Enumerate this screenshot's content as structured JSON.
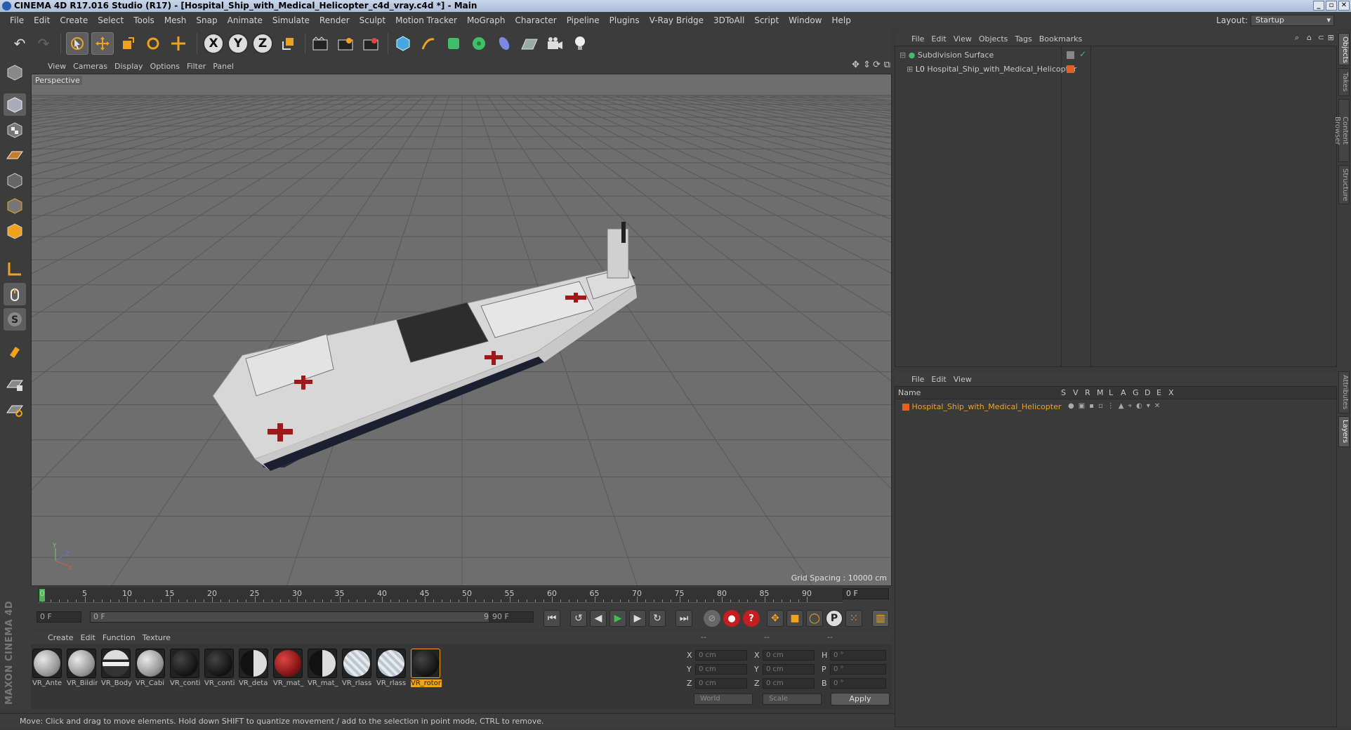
{
  "window": {
    "title": "CINEMA 4D R17.016 Studio (R17) - [Hospital_Ship_with_Medical_Helicopter_c4d_vray.c4d *] - Main"
  },
  "menubar": {
    "items": [
      "File",
      "Edit",
      "Create",
      "Select",
      "Tools",
      "Mesh",
      "Snap",
      "Animate",
      "Simulate",
      "Render",
      "Sculpt",
      "Motion Tracker",
      "MoGraph",
      "Character",
      "Pipeline",
      "Plugins",
      "V-Ray Bridge",
      "3DToAll",
      "Script",
      "Window",
      "Help"
    ],
    "layout_label": "Layout:",
    "layout_value": "Startup"
  },
  "toolbar": {
    "axis_x": "X",
    "axis_y": "Y",
    "axis_z": "Z"
  },
  "viewport": {
    "menu": [
      "View",
      "Cameras",
      "Display",
      "Options",
      "Filter",
      "Panel"
    ],
    "camera_label": "Perspective",
    "grid_spacing": "Grid Spacing : 10000 cm",
    "background_color": "#6e6e6e"
  },
  "timeline": {
    "ticks": [
      "0",
      "5",
      "10",
      "15",
      "20",
      "25",
      "30",
      "35",
      "40",
      "45",
      "50",
      "55",
      "60",
      "65",
      "70",
      "75",
      "80",
      "85",
      "90"
    ],
    "current_frame": "0 F"
  },
  "transport": {
    "start_field": "0 F",
    "range_start": "0 F",
    "range_end": "90 F",
    "end_field": "90 F"
  },
  "material_manager": {
    "menu": [
      "Create",
      "Edit",
      "Function",
      "Texture"
    ],
    "materials": [
      {
        "name": "VR_Ante",
        "style": "metal"
      },
      {
        "name": "VR_Bildir",
        "style": "metal"
      },
      {
        "name": "VR_Body",
        "style": "stripe"
      },
      {
        "name": "VR_Cabi",
        "style": "metal"
      },
      {
        "name": "VR_conti",
        "style": "dark"
      },
      {
        "name": "VR_conti",
        "style": "dark"
      },
      {
        "name": "VR_deta",
        "style": "dark-red"
      },
      {
        "name": "VR_mat_",
        "style": "red"
      },
      {
        "name": "VR_mat_",
        "style": "dark-red"
      },
      {
        "name": "VR_rlass",
        "style": "glass"
      },
      {
        "name": "VR_rlass",
        "style": "glass"
      },
      {
        "name": "VR_rotor",
        "style": "dark",
        "selected": true
      }
    ]
  },
  "coordinates": {
    "header": [
      "--",
      "--",
      "--"
    ],
    "rows": [
      {
        "pos_label": "X",
        "pos": "0 cm",
        "size_label": "X",
        "size": "0 cm",
        "rot_label": "H",
        "rot": "0 °"
      },
      {
        "pos_label": "Y",
        "pos": "0 cm",
        "size_label": "Y",
        "size": "0 cm",
        "rot_label": "P",
        "rot": "0 °"
      },
      {
        "pos_label": "Z",
        "pos": "0 cm",
        "size_label": "Z",
        "size": "0 cm",
        "rot_label": "B",
        "rot": "0 °"
      }
    ],
    "mode_world": "World",
    "mode_scale": "Scale",
    "apply": "Apply"
  },
  "branding": {
    "text": "MAXON CINEMA 4D"
  },
  "statusbar": {
    "text": "Move: Click and drag to move elements. Hold down SHIFT to quantize movement / add to the selection in point mode, CTRL to remove."
  },
  "object_manager": {
    "menu": [
      "File",
      "Edit",
      "View",
      "Objects",
      "Tags",
      "Bookmarks"
    ],
    "objects": [
      {
        "name": "Subdivision Surface",
        "icon": "subdivision-icon"
      },
      {
        "name": "Hospital_Ship_with_Medical_Helicopter",
        "icon": "null-object-icon"
      }
    ]
  },
  "layer_manager": {
    "menu": [
      "File",
      "Edit",
      "View"
    ],
    "columns": [
      "Name",
      "S",
      "V",
      "R",
      "M",
      "L",
      "A",
      "G",
      "D",
      "E",
      "X"
    ],
    "layers": [
      {
        "name": "Hospital_Ship_with_Medical_Helicopter",
        "color": "#e0621c"
      }
    ]
  },
  "side_tabs": {
    "upper": [
      "Objects",
      "Takes",
      "Content Browser",
      "Structure"
    ],
    "lower": [
      "Attributes",
      "Layers"
    ]
  },
  "colors": {
    "accent": "#f0a21e",
    "selection_orange": "#e0621c"
  }
}
